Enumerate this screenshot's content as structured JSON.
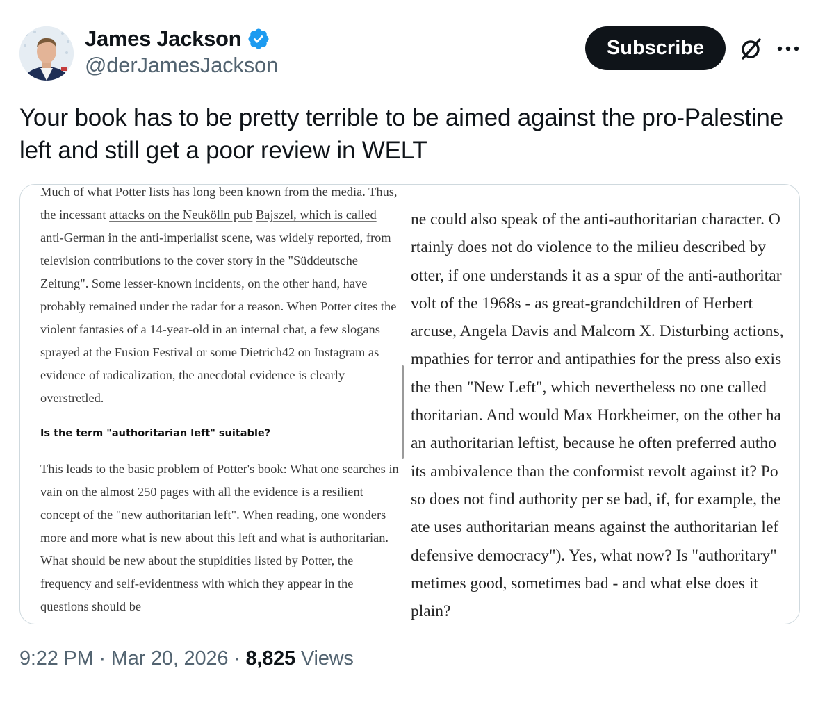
{
  "author": {
    "name": "James Jackson",
    "handle": "@derJamesJackson",
    "verified": true,
    "verified_color": "#1d9bf0"
  },
  "actions": {
    "subscribe_label": "Subscribe",
    "grok_icon": "grok-icon",
    "more_icon": "more-options-icon"
  },
  "tweet": {
    "text": "Your book has to be pretty terrible to be aimed against the pro-Palestine left and still get a poor review in WELT"
  },
  "media": {
    "left_column": {
      "para1_top": "Much of what Potter lists has long been known from the",
      "para1_line2_a": "media. Thus, the incessant ",
      "para1_link1": "attacks on the Neukölln pub",
      "para1_link2": "Bajszel, which is called anti-German in the anti-imperialist",
      "para1_link3": "scene, was",
      "para1_rest": " widely reported, from television contributions to the cover story in the \"Süddeutsche Zeitung\". Some lesser-known incidents, on the other hand, have probably remained under the radar for a reason. When Potter cites the violent fantasies of a 14-year-old in an internal chat, a few slogans sprayed at the Fusion Festival or some Dietrich42 on Instagram as evidence of radicalization, the anecdotal evidence is clearly overstretled.",
      "heading": "Is the term \"authoritarian left\" suitable?",
      "para2": "This leads to the basic problem of Potter's book: What one searches in vain on the almost 250 pages with all the evidence is a resilient concept of the \"new authoritarian left\". When reading, one wonders more and more what is new about this left and what is authoritarian. What should be new about the stupidities listed by Potter, the frequency and self-evidentness with which they appear in the  questions should be"
    },
    "right_column": {
      "lines": [
        "ne could also speak of the anti-authoritarian character. O",
        "rtainly does not do violence to the milieu described by",
        "otter, if one understands it as a spur of the anti-authoritar",
        "volt of the 1968s - as great-grandchildren of Herbert",
        "arcuse, Angela Davis and Malcom X. Disturbing actions,",
        "mpathies for terror and antipathies for the press also exis",
        " the then \"New Left\", which nevertheless no one called",
        "thoritarian. And would Max Horkheimer, on the other ha",
        " an authoritarian leftist, because he often preferred autho",
        " its ambivalence than the conformist revolt against it? Po",
        "so does not find authority per se bad, if, for example, the",
        "ate uses authoritarian means against the authoritarian lef",
        "defensive democracy\"). Yes, what now? Is \"authoritary\"",
        "metimes good, sometimes bad - and what else does it",
        "plain?"
      ]
    }
  },
  "meta": {
    "time": "9:22 PM",
    "separator": " · ",
    "date": "Mar 20, 2026",
    "views_count": "8,825",
    "views_label": " Views"
  }
}
